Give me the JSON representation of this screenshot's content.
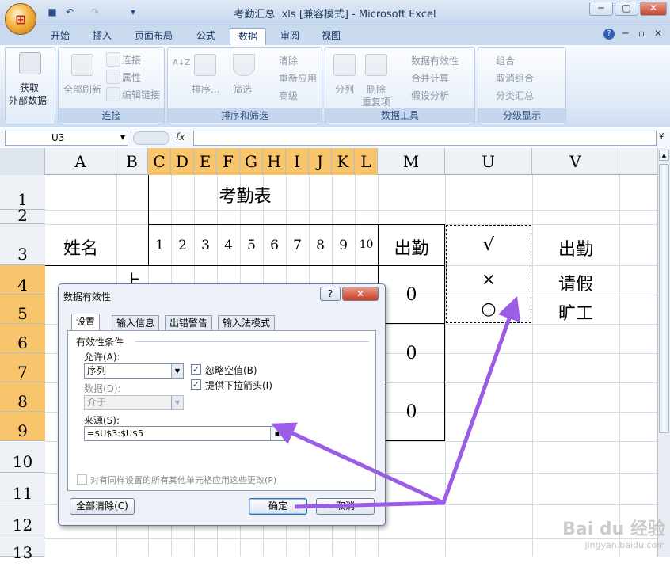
{
  "window": {
    "title": "考勤汇总 .xls  [兼容模式] - Microsoft Excel",
    "office_glyph": "⊞",
    "min": "─",
    "max": "▢",
    "close": "✕"
  },
  "ribbon_tabs": [
    "开始",
    "插入",
    "页面布局",
    "公式",
    "数据",
    "审阅",
    "视图"
  ],
  "ribbon": {
    "get_external": "获取",
    "get_external2": "外部数据",
    "refresh_all": "全部刷新",
    "connections": "连接",
    "properties": "属性",
    "edit_links": "编辑链接",
    "sort_asc": "A↓Z",
    "sort": "排序...",
    "filter": "筛选",
    "clear": "清除",
    "reapply": "重新应用",
    "advanced": "高级",
    "text_to_cols": "分列",
    "remove_dup1": "删除",
    "remove_dup2": "重复项",
    "validation": "数据有效性",
    "consolidate": "合并计算",
    "whatif": "假设分析",
    "group": "组合",
    "ungroup": "取消组合",
    "subtotal": "分类汇总",
    "group_labels": [
      "连接",
      "排序和筛选",
      "数据工具",
      "分级显示"
    ]
  },
  "formula_bar": {
    "name_box": "U3",
    "fx": "fx",
    "value": ""
  },
  "columns": [
    "A",
    "B",
    "C",
    "D",
    "E",
    "F",
    "G",
    "H",
    "I",
    "J",
    "K",
    "L",
    "M",
    "U",
    "V"
  ],
  "rows": [
    "1",
    "2",
    "3",
    "4",
    "5",
    "6",
    "7",
    "8",
    "9",
    "10",
    "11",
    "12",
    "13"
  ],
  "sheet": {
    "title": "考勤表",
    "name_header": "姓名",
    "day_headers": [
      "1",
      "2",
      "3",
      "4",
      "5",
      "6",
      "7",
      "8",
      "9",
      "10"
    ],
    "attend_header": "出勤",
    "b4": "上",
    "m_values": [
      "0",
      "0",
      "0"
    ],
    "u_list": [
      "√",
      "×",
      "○"
    ],
    "v_list": [
      "出勤",
      "请假",
      "旷工"
    ]
  },
  "dialog": {
    "title": "数据有效性",
    "help": "?",
    "close": "✕",
    "tabs": [
      "设置",
      "输入信息",
      "出错警告",
      "输入法模式"
    ],
    "section": "有效性条件",
    "allow_label": "允许(A):",
    "allow_value": "序列",
    "data_label": "数据(D):",
    "data_value": "介于",
    "ignore_blank": "忽略空值(B)",
    "in_cell_dropdown": "提供下拉箭头(I)",
    "source_label": "来源(S):",
    "source_value": "=$U$3:$U$5",
    "apply_all": "对有同样设置的所有其他单元格应用这些更改(P)",
    "clear_all": "全部清除(C)",
    "ok": "确定",
    "cancel": "取消",
    "check": "✓"
  },
  "watermark": {
    "brand": "Bai du 经验",
    "url": "jingyan.baidu.com"
  },
  "colors": {
    "arrow": "#9b5de5",
    "selected_header": "#f8c46c"
  }
}
